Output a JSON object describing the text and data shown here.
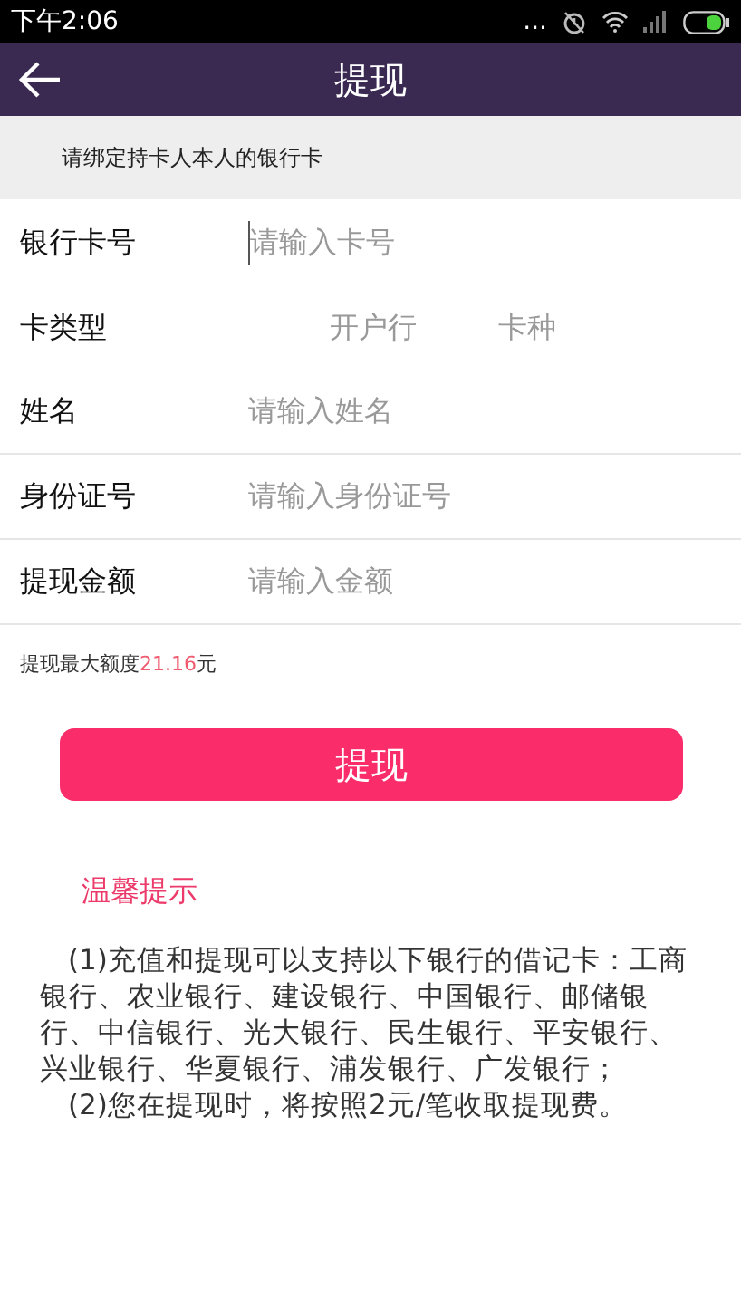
{
  "status_bar": {
    "time": "下午2:06",
    "dots": "..."
  },
  "header": {
    "title": "提现"
  },
  "banner": {
    "text": "请绑定持卡人本人的银行卡"
  },
  "fields": [
    {
      "kind": "input",
      "label": "银行卡号",
      "placeholder": "请输入卡号",
      "focused": true,
      "divider": false
    },
    {
      "kind": "pair",
      "label": "卡类型",
      "options": [
        "开户行",
        "卡种"
      ],
      "divider": false
    },
    {
      "kind": "input",
      "label": "姓名",
      "placeholder": "请输入姓名",
      "focused": false,
      "divider": true
    },
    {
      "kind": "input",
      "label": "身份证号",
      "placeholder": "请输入身份证号",
      "focused": false,
      "divider": true
    },
    {
      "kind": "input",
      "label": "提现金额",
      "placeholder": "请输入金额",
      "focused": false,
      "divider": true
    }
  ],
  "limit": {
    "label": "提现最大额度",
    "value": "21.16",
    "unit": "元"
  },
  "submit_button": "提现",
  "tips": {
    "title": "温馨提示",
    "paragraphs": [
      "(1)充值和提现可以支持以下银行的借记卡：工商银行、农业银行、建设银行、中国银行、邮储银行、中信银行、光大银行、民生银行、平安银行、兴业银行、华夏银行、浦发银行、广发银行；",
      "(2)您在提现时，将按照2元/笔收取提现费。"
    ]
  }
}
